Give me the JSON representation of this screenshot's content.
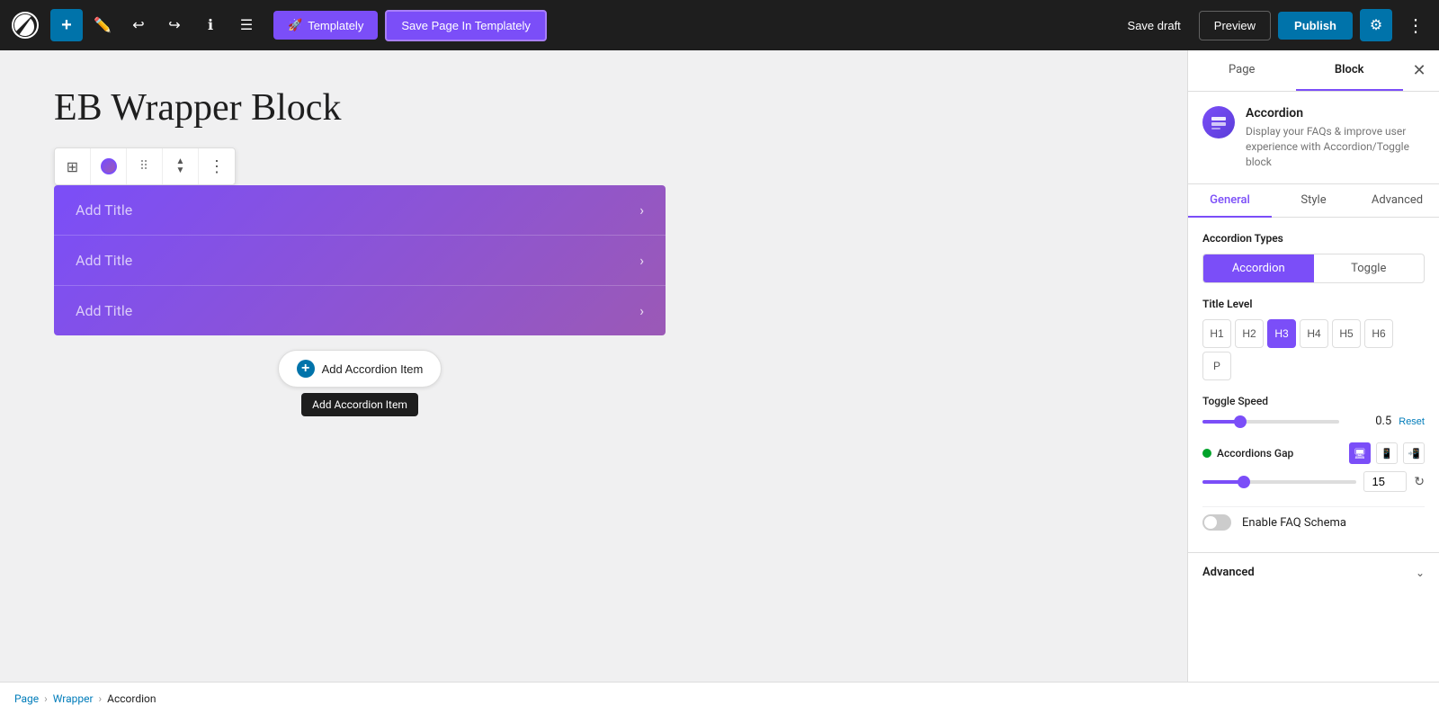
{
  "toolbar": {
    "add_label": "+",
    "templately_label": "Templately",
    "save_templately_label": "Save Page In Templately",
    "save_draft_label": "Save draft",
    "preview_label": "Preview",
    "publish_label": "Publish"
  },
  "editor": {
    "page_title": "EB Wrapper Block",
    "accordion_items": [
      {
        "title": "Add Title"
      },
      {
        "title": "Add Title"
      },
      {
        "title": "Add Title"
      }
    ],
    "add_accordion_label": "Add Accordion Item",
    "add_accordion_tooltip": "Add Accordion Item"
  },
  "breadcrumb": {
    "page": "Page",
    "wrapper": "Wrapper",
    "current": "Accordion"
  },
  "sidebar": {
    "tab_page": "Page",
    "tab_block": "Block",
    "block_name": "Accordion",
    "block_description": "Display your FAQs & improve user experience with Accordion/Toggle block",
    "panel_general": "General",
    "panel_style": "Style",
    "panel_advanced": "Advanced",
    "accordion_types_label": "Accordion Types",
    "accordion_option": "Accordion",
    "toggle_option": "Toggle",
    "title_level_label": "Title Level",
    "title_levels": [
      "H1",
      "H2",
      "H3",
      "H4",
      "H5",
      "H6",
      "P"
    ],
    "active_level": "H3",
    "toggle_speed_label": "Toggle Speed",
    "toggle_speed_value": "0.5",
    "reset_label": "Reset",
    "accordions_gap_label": "Accordions Gap",
    "accordions_gap_value": "15",
    "enable_faq_label": "Enable FAQ Schema",
    "advanced_label": "Advanced"
  }
}
